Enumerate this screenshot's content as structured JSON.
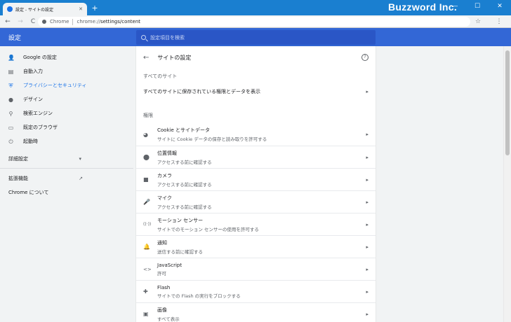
{
  "browser": {
    "tab_title": "設定 - サイトの設定",
    "tab_close": "✕",
    "new_tab": "+",
    "watermark": "Buzzword Inc.",
    "window_controls": [
      "—",
      "☐",
      "✕"
    ],
    "back": "←",
    "forward": "→",
    "reload": "C",
    "omnibox_scheme": "Chrome",
    "omnibox_url_host": "chrome://",
    "omnibox_url_path": "settings/content",
    "star": "☆",
    "menu": "⋮"
  },
  "header": {
    "title": "設定",
    "search_placeholder": "設定項目を検索"
  },
  "sidebar": {
    "items": [
      {
        "label": "Google の設定",
        "icon": "person-icon",
        "glyph": "👤"
      },
      {
        "label": "自動入力",
        "icon": "clipboard-icon",
        "glyph": "▤"
      },
      {
        "label": "プライバシーとセキュリティ",
        "icon": "shield-icon",
        "glyph": "⛨"
      },
      {
        "label": "デザイン",
        "icon": "palette-icon",
        "glyph": "●"
      },
      {
        "label": "検索エンジン",
        "icon": "search-icon",
        "glyph": "⚲"
      },
      {
        "label": "既定のブラウザ",
        "icon": "browser-icon",
        "glyph": "▭"
      },
      {
        "label": "起動時",
        "icon": "power-icon",
        "glyph": "⏻"
      }
    ],
    "advanced": "詳細設定",
    "advanced_caret": "▾",
    "extensions": "拡張機能",
    "extensions_icon": "↗",
    "about": "Chrome について"
  },
  "main": {
    "back": "←",
    "page_title": "サイトの設定",
    "help": "?",
    "all_sites_heading": "すべてのサイト",
    "all_sites_row": "すべてのサイトに保存されている権限とデータを表示",
    "permissions_heading": "権限",
    "arrow": "▸",
    "permissions": [
      {
        "title": "Cookie とサイトデータ",
        "desc": "サイトに Cookie データの保存と読み取りを許可する",
        "icon": "cookie-icon",
        "glyph": "◕"
      },
      {
        "title": "位置情報",
        "desc": "アクセスする前に確認する",
        "icon": "location-icon",
        "glyph": "⬤"
      },
      {
        "title": "カメラ",
        "desc": "アクセスする前に確認する",
        "icon": "camera-icon",
        "glyph": "■"
      },
      {
        "title": "マイク",
        "desc": "アクセスする前に確認する",
        "icon": "mic-icon",
        "glyph": "🎤"
      },
      {
        "title": "モーション センサー",
        "desc": "サイトでのモーション センサーの使用を許可する",
        "icon": "sensor-icon",
        "glyph": "((·))"
      },
      {
        "title": "通知",
        "desc": "送信する前に確認する",
        "icon": "bell-icon",
        "glyph": "🔔"
      },
      {
        "title": "JavaScript",
        "desc": "許可",
        "icon": "code-icon",
        "glyph": "<>"
      },
      {
        "title": "Flash",
        "desc": "サイトでの Flash の実行をブロックする",
        "icon": "puzzle-icon",
        "glyph": "✚"
      },
      {
        "title": "画像",
        "desc": "すべて表示",
        "icon": "image-icon",
        "glyph": "▣"
      }
    ]
  },
  "colors": {
    "titlebar": "#1a7fd0",
    "header": "#3367d6",
    "search": "#2a56c6",
    "active": "#1a73e8"
  }
}
